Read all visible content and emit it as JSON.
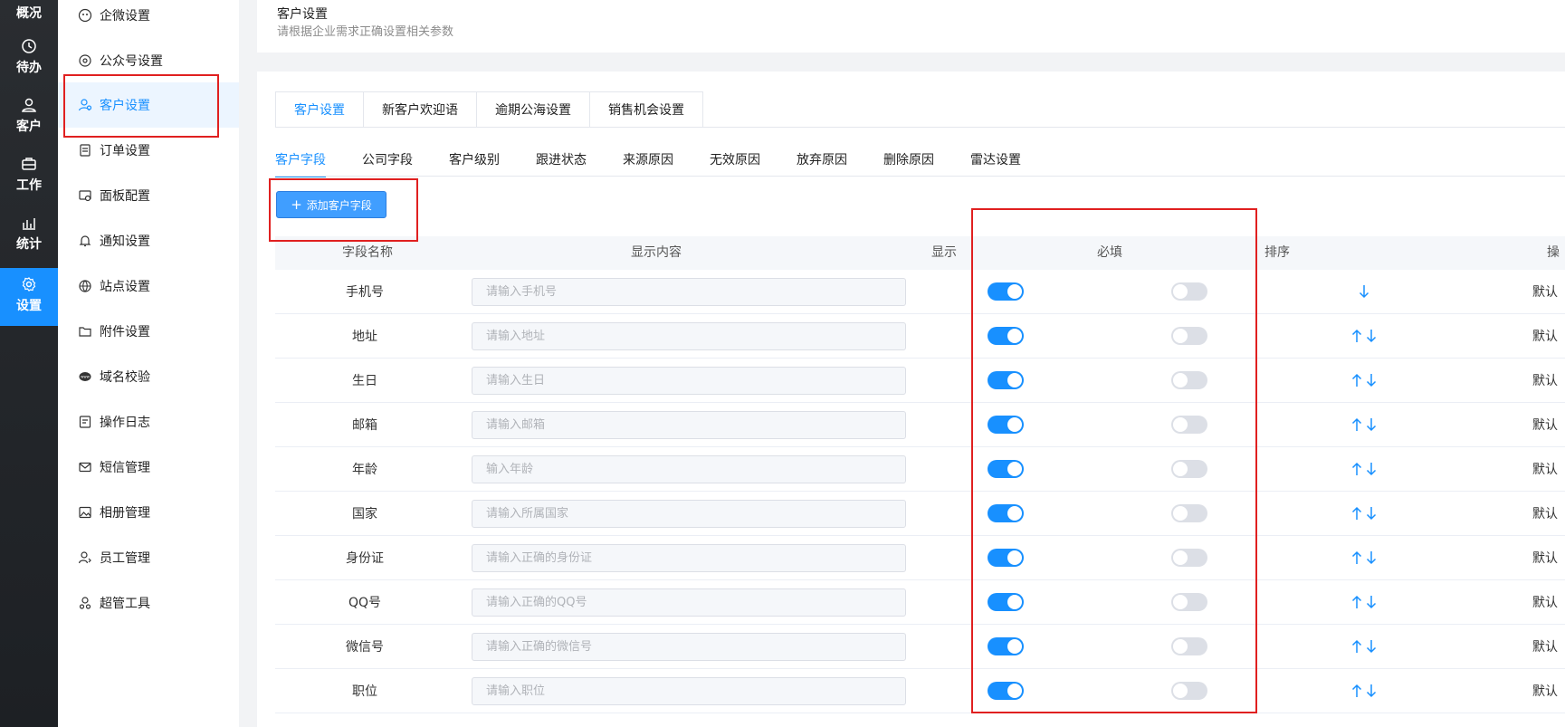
{
  "rail": [
    {
      "label": "概况",
      "icon": "overview-icon",
      "active": false
    },
    {
      "label": "待办",
      "icon": "clock-icon",
      "active": false
    },
    {
      "label": "客户",
      "icon": "user-icon",
      "active": false
    },
    {
      "label": "工作",
      "icon": "briefcase-icon",
      "active": false
    },
    {
      "label": "统计",
      "icon": "chart-icon",
      "active": false
    },
    {
      "label": "设置",
      "icon": "gear-icon",
      "active": true
    }
  ],
  "sidebar": [
    {
      "label": "企微设置",
      "icon": "wecom-icon"
    },
    {
      "label": "公众号设置",
      "icon": "official-account-icon"
    },
    {
      "label": "客户设置",
      "icon": "customer-icon",
      "active": true
    },
    {
      "label": "订单设置",
      "icon": "order-icon"
    },
    {
      "label": "面板配置",
      "icon": "panel-icon"
    },
    {
      "label": "通知设置",
      "icon": "bell-icon"
    },
    {
      "label": "站点设置",
      "icon": "globe-icon"
    },
    {
      "label": "附件设置",
      "icon": "folder-icon"
    },
    {
      "label": "域名校验",
      "icon": "domain-icon"
    },
    {
      "label": "操作日志",
      "icon": "log-icon"
    },
    {
      "label": "短信管理",
      "icon": "mail-icon"
    },
    {
      "label": "相册管理",
      "icon": "album-icon"
    },
    {
      "label": "员工管理",
      "icon": "staff-icon"
    },
    {
      "label": "超管工具",
      "icon": "admin-icon"
    }
  ],
  "header": {
    "title": "客户设置",
    "subtitle": "请根据企业需求正确设置相关参数"
  },
  "top_tabs": [
    "客户设置",
    "新客户欢迎语",
    "逾期公海设置",
    "销售机会设置"
  ],
  "sub_tabs": [
    "客户字段",
    "公司字段",
    "客户级别",
    "跟进状态",
    "来源原因",
    "无效原因",
    "放弃原因",
    "删除原因",
    "雷达设置"
  ],
  "add_button": {
    "plus": "+",
    "label": "添加客户字段"
  },
  "table": {
    "headers": {
      "name": "字段名称",
      "content": "显示内容",
      "show": "显示",
      "required": "必填",
      "sort": "排序",
      "op": "操"
    },
    "rows": [
      {
        "name": "手机号",
        "placeholder": "请输入手机号",
        "show": true,
        "required": false,
        "up": false,
        "down": true,
        "op": "默认"
      },
      {
        "name": "地址",
        "placeholder": "请输入地址",
        "show": true,
        "required": false,
        "up": true,
        "down": true,
        "op": "默认"
      },
      {
        "name": "生日",
        "placeholder": "请输入生日",
        "show": true,
        "required": false,
        "up": true,
        "down": true,
        "op": "默认"
      },
      {
        "name": "邮箱",
        "placeholder": "请输入邮箱",
        "show": true,
        "required": false,
        "up": true,
        "down": true,
        "op": "默认"
      },
      {
        "name": "年龄",
        "placeholder": "输入年龄",
        "show": true,
        "required": false,
        "up": true,
        "down": true,
        "op": "默认"
      },
      {
        "name": "国家",
        "placeholder": "请输入所属国家",
        "show": true,
        "required": false,
        "up": true,
        "down": true,
        "op": "默认"
      },
      {
        "name": "身份证",
        "placeholder": "请输入正确的身份证",
        "show": true,
        "required": false,
        "up": true,
        "down": true,
        "op": "默认"
      },
      {
        "name": "QQ号",
        "placeholder": "请输入正确的QQ号",
        "show": true,
        "required": false,
        "up": true,
        "down": true,
        "op": "默认"
      },
      {
        "name": "微信号",
        "placeholder": "请输入正确的微信号",
        "show": true,
        "required": false,
        "up": true,
        "down": true,
        "op": "默认"
      },
      {
        "name": "职位",
        "placeholder": "请输入职位",
        "show": true,
        "required": false,
        "up": true,
        "down": true,
        "op": "默认"
      }
    ]
  },
  "colors": {
    "accent": "#1890ff",
    "annotation": "#e02020"
  }
}
